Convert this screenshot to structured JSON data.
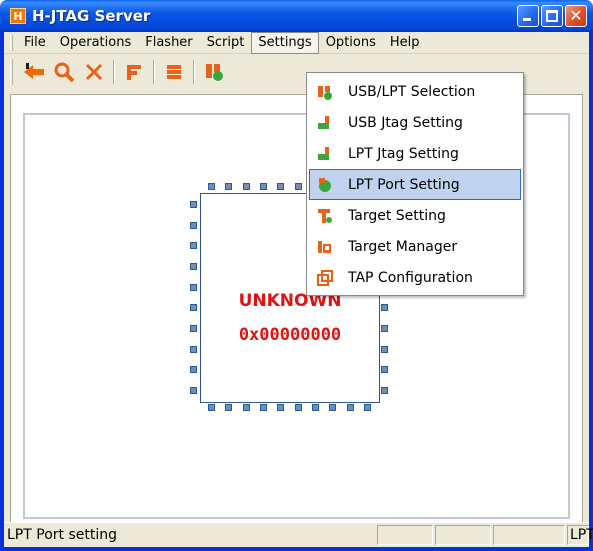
{
  "window": {
    "title": "H-JTAG Server",
    "icon_letter": "H"
  },
  "menubar": {
    "items": [
      {
        "label": "File"
      },
      {
        "label": "Operations"
      },
      {
        "label": "Flasher"
      },
      {
        "label": "Script"
      },
      {
        "label": "Settings"
      },
      {
        "label": "Options"
      },
      {
        "label": "Help"
      }
    ]
  },
  "toolbar": {
    "buttons": [
      {
        "icon": "connect-arrow-icon"
      },
      {
        "icon": "search-icon"
      },
      {
        "icon": "close-x-icon"
      },
      {
        "icon": "flasher-f-icon"
      },
      {
        "icon": "script-s-icon"
      },
      {
        "icon": "usb-lpt-icon"
      }
    ]
  },
  "settings_menu": {
    "items": [
      {
        "label": "USB/LPT Selection",
        "icon": "usb-lpt-selection-icon"
      },
      {
        "label": "USB Jtag Setting",
        "icon": "usb-jtag-icon"
      },
      {
        "label": "LPT Jtag Setting",
        "icon": "lpt-jtag-icon"
      },
      {
        "label": "LPT Port Setting",
        "icon": "lpt-port-icon",
        "highlighted": true
      },
      {
        "label": "Target Setting",
        "icon": "target-setting-icon"
      },
      {
        "label": "Target Manager",
        "icon": "target-manager-icon"
      },
      {
        "label": "TAP Configuration",
        "icon": "tap-config-icon"
      }
    ]
  },
  "chip": {
    "name": "UNKNOWN",
    "id": "0x00000000",
    "color": "#e51010"
  },
  "statusbar": {
    "text": "LPT Port setting",
    "panel_right": "LPT"
  }
}
